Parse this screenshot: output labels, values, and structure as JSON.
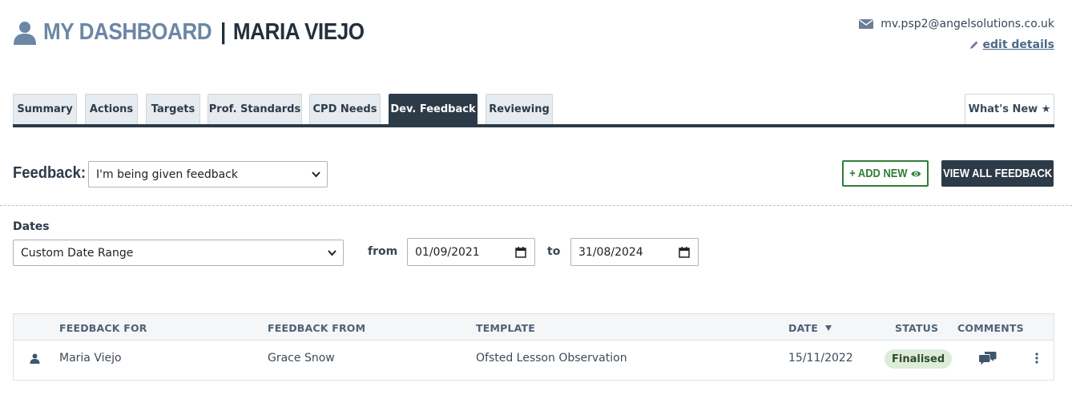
{
  "header": {
    "title": "MY DASHBOARD",
    "separator": "|",
    "user_name": "MARIA VIEJO",
    "email": "mv.psp2@angelsolutions.co.uk",
    "edit_link": "edit details",
    "icons": {
      "user": "user-icon",
      "mail": "mail-icon",
      "edit": "pencil-icon"
    }
  },
  "tabs": [
    {
      "label": "Summary",
      "active": false
    },
    {
      "label": "Actions",
      "active": false
    },
    {
      "label": "Targets",
      "active": false
    },
    {
      "label": "Prof. Standards",
      "active": false
    },
    {
      "label": "CPD Needs",
      "active": false
    },
    {
      "label": "Dev. Feedback",
      "active": true
    },
    {
      "label": "Reviewing",
      "active": false
    }
  ],
  "whats_new": "What's New ★",
  "feedback": {
    "label": "Feedback:",
    "selected": "I'm being given feedback",
    "add_new_label": "+ ADD NEW",
    "view_all_label": "VIEW ALL FEEDBACK"
  },
  "dates": {
    "label": "Dates",
    "range_selected": "Custom Date Range",
    "from_label": "from",
    "from_value": "01/09/2021",
    "to_label": "to",
    "to_value": "31/08/2024"
  },
  "table": {
    "columns": [
      "FEEDBACK FOR",
      "FEEDBACK FROM",
      "TEMPLATE",
      "DATE",
      "STATUS",
      "COMMENTS"
    ],
    "sort_column": "DATE",
    "sort_direction": "descending",
    "rows": [
      {
        "feedback_for": "Maria Viejo",
        "feedback_from": "Grace Snow",
        "template": "Ofsted Lesson Observation",
        "date": "15/11/2022",
        "status": "Finalised"
      }
    ]
  },
  "colors": {
    "primary_dark": "#2d3a48",
    "muted_blue": "#6b87a5",
    "success_green": "#2f7d3b",
    "status_bg": "#dcecd9"
  }
}
